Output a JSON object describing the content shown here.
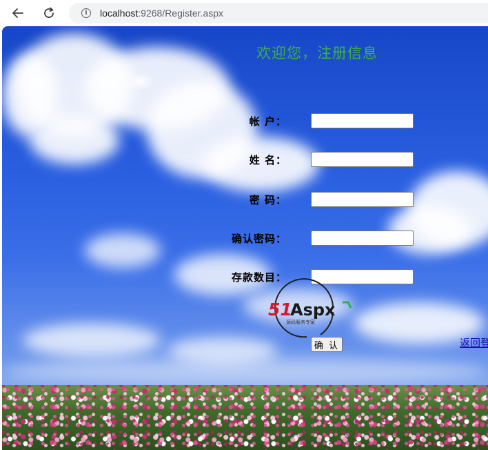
{
  "browser": {
    "url_host": "localhost",
    "url_path": ":9268/Register.aspx"
  },
  "page": {
    "title": "欢迎您，注册信息",
    "fields": [
      {
        "label": "帐 户：",
        "value": ""
      },
      {
        "label": "姓 名：",
        "value": ""
      },
      {
        "label": "密 码：",
        "value": ""
      },
      {
        "label": "确认密码：",
        "value": ""
      },
      {
        "label": "存款数目：",
        "value": ""
      }
    ],
    "submit_label": "确 认",
    "return_link": "返回登录"
  },
  "watermark": {
    "brand_red": "51",
    "brand_black": "Aspx",
    "tagline": "源码服务专家"
  },
  "colors": {
    "title": "#3cb043",
    "link": "#1a0dab",
    "sky": "#2a5fe0"
  },
  "icons": [
    "back-arrow-icon",
    "reload-icon",
    "info-icon"
  ]
}
